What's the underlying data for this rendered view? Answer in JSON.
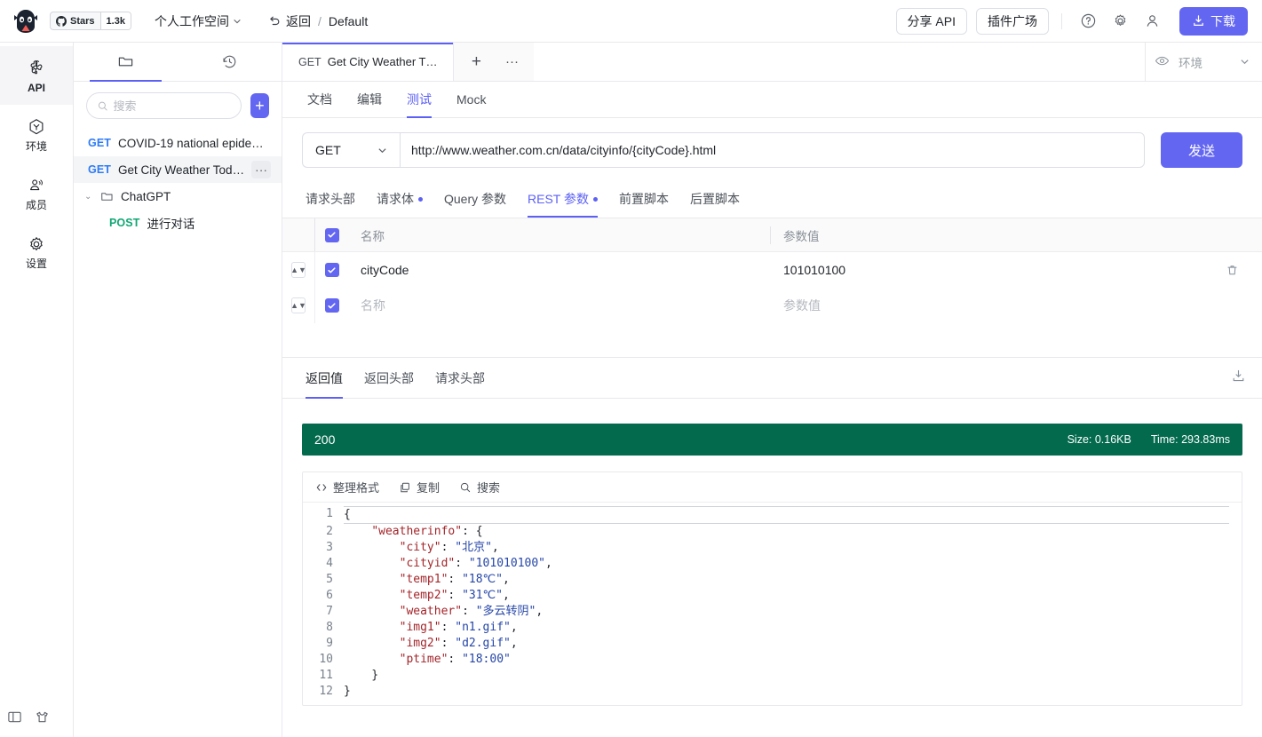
{
  "topbar": {
    "stars_label": "Stars",
    "stars_count": "1.3k",
    "workspace": "个人工作空间",
    "back_label": "返回",
    "crumb_sep": "/",
    "crumb_current": "Default",
    "share_api": "分享 API",
    "plugin_market": "插件广场",
    "help_icon": "help-circle-icon",
    "settings_icon": "gear-icon",
    "account_icon": "user-icon",
    "download_label": "下载"
  },
  "rail": {
    "items": [
      {
        "label": "API",
        "icon": "api-icon",
        "active": true
      },
      {
        "label": "环境",
        "icon": "environment-icon",
        "active": false
      },
      {
        "label": "成员",
        "icon": "members-icon",
        "active": false
      },
      {
        "label": "设置",
        "icon": "settings-icon",
        "active": false
      }
    ],
    "bottom": [
      {
        "icon": "panel-toggle-icon"
      },
      {
        "icon": "theme-shirt-icon"
      }
    ]
  },
  "panel": {
    "tabs": [
      {
        "icon": "folder-icon",
        "active": true
      },
      {
        "icon": "history-icon",
        "active": false
      }
    ],
    "search_placeholder": "搜索",
    "add_label": "+",
    "tree": [
      {
        "type": "api",
        "method": "GET",
        "name": "COVID-19 national epide…",
        "selected": false,
        "indent": false
      },
      {
        "type": "api",
        "method": "GET",
        "name": "Get City Weather Today",
        "selected": true,
        "indent": false,
        "more": "···"
      },
      {
        "type": "folder",
        "name": "ChatGPT",
        "caret": "⌄",
        "selected": false,
        "indent": false
      },
      {
        "type": "api",
        "method": "POST",
        "name": "进行对话",
        "selected": false,
        "indent": true
      }
    ]
  },
  "main": {
    "doc_tab": {
      "method": "GET",
      "title": "Get City Weather T…"
    },
    "tab_add": "+",
    "tab_more": "···",
    "env": {
      "icon": "eye-icon",
      "placeholder": "环境",
      "caret": "⌄"
    },
    "subtabs": [
      {
        "label": "文档",
        "active": false
      },
      {
        "label": "编辑",
        "active": false
      },
      {
        "label": "测试",
        "active": true
      },
      {
        "label": "Mock",
        "active": false
      }
    ],
    "request": {
      "method": "GET",
      "url": "http://www.weather.com.cn/data/cityinfo/{cityCode}.html",
      "send_label": "发送"
    },
    "param_tabs": [
      {
        "label": "请求头部",
        "dot": false,
        "active": false
      },
      {
        "label": "请求体",
        "dot": true,
        "active": false
      },
      {
        "label": "Query 参数",
        "dot": false,
        "active": false
      },
      {
        "label": "REST 参数",
        "dot": true,
        "active": true
      },
      {
        "label": "前置脚本",
        "dot": false,
        "active": false
      },
      {
        "label": "后置脚本",
        "dot": false,
        "active": false
      }
    ],
    "param_table": {
      "headers": {
        "name": "名称",
        "value": "参数值"
      },
      "rows": [
        {
          "checked": true,
          "name": "cityCode",
          "value": "101010100",
          "name_placeholder": "",
          "value_placeholder": "",
          "delete_icon": "trash-icon"
        },
        {
          "checked": true,
          "name": "",
          "value": "",
          "name_placeholder": "名称",
          "value_placeholder": "参数值",
          "delete_icon": ""
        }
      ]
    },
    "response": {
      "tabs": [
        {
          "label": "返回值",
          "active": true
        },
        {
          "label": "返回头部",
          "active": false
        },
        {
          "label": "请求头部",
          "active": false
        }
      ],
      "download_icon": "download-icon",
      "status_code": "200",
      "size": "Size: 0.16KB",
      "time": "Time: 293.83ms",
      "status_color": "#046a4e",
      "tools": [
        {
          "label": "整理格式",
          "icon": "code-icon"
        },
        {
          "label": "复制",
          "icon": "copy-icon"
        },
        {
          "label": "搜索",
          "icon": "search-icon"
        }
      ],
      "code_lines": [
        {
          "n": "1",
          "text": "{"
        },
        {
          "n": "2",
          "text": "    \"weatherinfo\": {"
        },
        {
          "n": "3",
          "text": "        \"city\": \"北京\","
        },
        {
          "n": "4",
          "text": "        \"cityid\": \"101010100\","
        },
        {
          "n": "5",
          "text": "        \"temp1\": \"18℃\","
        },
        {
          "n": "6",
          "text": "        \"temp2\": \"31℃\","
        },
        {
          "n": "7",
          "text": "        \"weather\": \"多云转阴\","
        },
        {
          "n": "8",
          "text": "        \"img1\": \"n1.gif\","
        },
        {
          "n": "9",
          "text": "        \"img2\": \"d2.gif\","
        },
        {
          "n": "10",
          "text": "        \"ptime\": \"18:00\""
        },
        {
          "n": "11",
          "text": "    }"
        },
        {
          "n": "12",
          "text": "}"
        }
      ]
    }
  },
  "colors": {
    "accent": "#6366f1",
    "accent_tab": "#5c60f5",
    "get": "#2d7bf6",
    "post": "#11a675",
    "status": "#046a4e"
  }
}
